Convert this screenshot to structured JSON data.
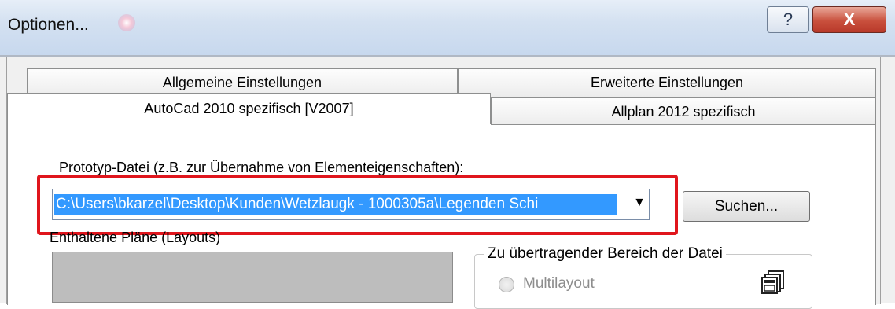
{
  "window": {
    "title": "Optionen...",
    "help_button": "?",
    "close_button": "X"
  },
  "tabs": {
    "row_back": [
      "Allgemeine Einstellungen",
      "Erweiterte Einstellungen"
    ],
    "row_front": [
      "AutoCad 2010 spezifisch [V2007]",
      "Allplan 2012 spezifisch"
    ],
    "active": "AutoCad 2010 spezifisch [V2007]"
  },
  "prototype": {
    "label": "Prototyp-Datei (z.B. zur Übernahme von Elementeigenschaften):",
    "path": "C:\\Users\\bkarzel\\Desktop\\Kunden\\Wetzlaugk - 1000305a\\Legenden Schi",
    "search_button": "Suchen..."
  },
  "layouts": {
    "label": "Enthaltene Pläne (Layouts)"
  },
  "transfer_group": {
    "title": "Zu übertragender Bereich der Datei",
    "option_multilayout": "Multilayout"
  },
  "colors": {
    "selection": "#3399ff",
    "highlight_box": "#e0161d"
  }
}
